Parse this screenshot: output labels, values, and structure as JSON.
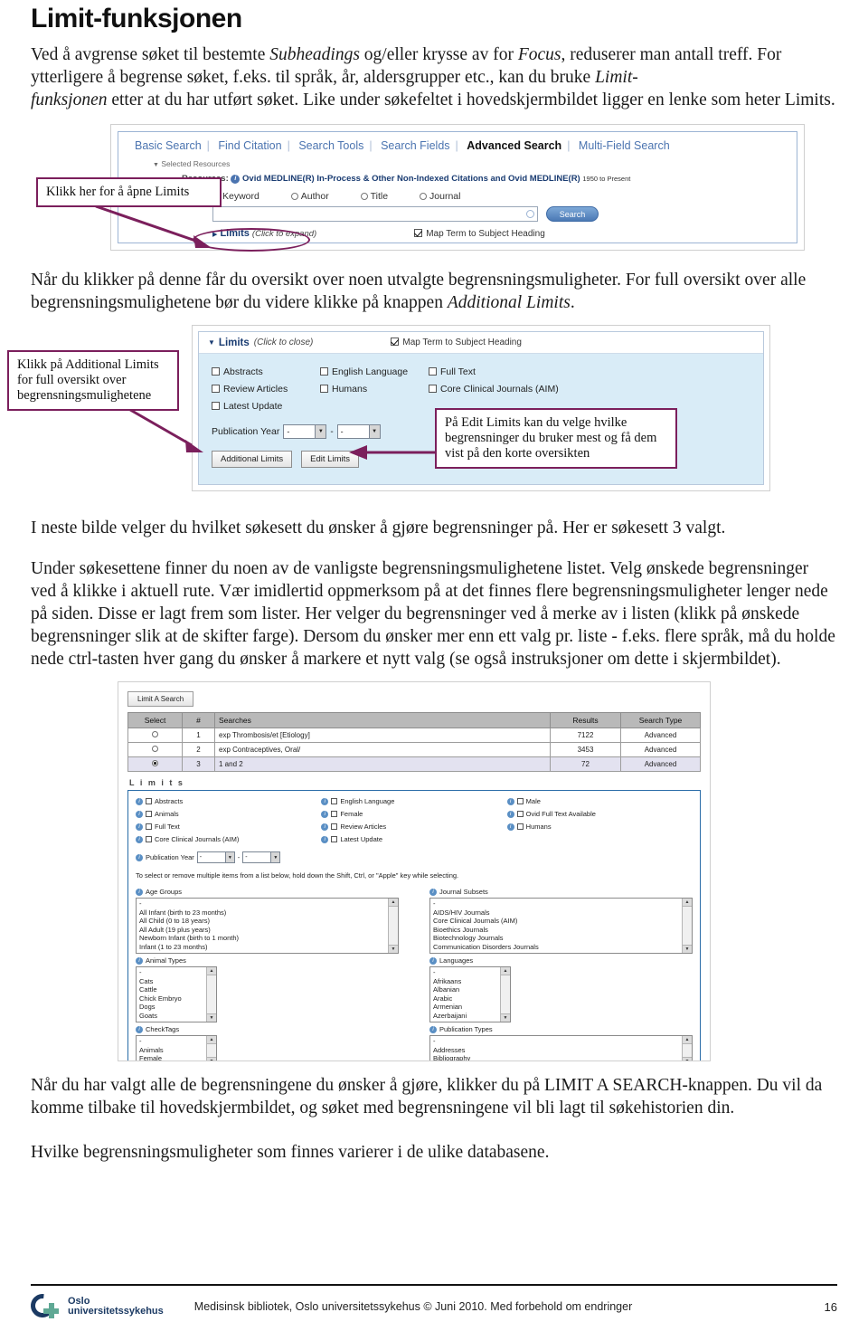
{
  "document": {
    "title": "Limit-funksjonen",
    "paragraphs": {
      "intro": "Ved å avgrense søket til bestemte Subheadings og/eller krysse av for Focus, reduserer man antall treff. For ytterligere å begrense søket, f.eks. til språk, år, aldersgrupper etc., kan du bruke Limit-funksjonen etter at du har utført søket. Like under søkefeltet i hovedskjermbildet ligger en lenke som heter Limits.",
      "after_shot1": "Når du klikker på denne får du oversikt over noen utvalgte begrensningsmuligheter. For full oversikt over alle begrensningsmulighetene bør du videre klikke på knappen Additional Limits.",
      "after_shot2_a": "I neste bilde velger du hvilket søkesett du ønsker å gjøre begrensninger på. Her er søkesett 3 valgt.",
      "after_shot2_b": "Under søkesettene finner du noen av de vanligste begrensningsmulighetene listet. Velg ønskede begrensninger ved å klikke i aktuell rute. Vær imidlertid oppmerksom på at det finnes flere begrensningsmuligheter lenger nede på siden. Disse er lagt frem som lister. Her velger du begrensninger ved å merke av i listen (klikk på ønskede begrensninger slik at de skifter farge). Dersom du ønsker mer enn ett valg pr. liste - f.eks. flere språk, må du holde nede ctrl-tasten hver gang du ønsker å markere et nytt valg (se også instruksjoner om dette i skjermbildet).",
      "after_shot3_a": "Når du har valgt alle de begrensningene du ønsker å gjøre, klikker du på LIMIT A SEARCH-knappen. Du vil da komme tilbake til hovedskjermbildet, og søket med begrensningene vil bli lagt til søkehistorien din.",
      "after_shot3_b": "Hvilke begrensningsmuligheter som finnes varierer i de ulike databasene."
    }
  },
  "callouts": {
    "open_limits": "Klikk her for å åpne Limits",
    "additional_limits": "Klikk på Additional Limits for full oversikt over begrensningsmulighetene",
    "edit_limits": "På Edit Limits kan du velge hvilke begrensninger du bruker mest og få dem vist på den korte oversikten"
  },
  "shot1": {
    "tabs": [
      {
        "label": "Basic Search",
        "active": false
      },
      {
        "label": "Find Citation",
        "active": false
      },
      {
        "label": "Search Tools",
        "active": false
      },
      {
        "label": "Search Fields",
        "active": false
      },
      {
        "label": "Advanced Search",
        "active": true
      },
      {
        "label": "Multi-Field Search",
        "active": false
      }
    ],
    "selected_resources": "Selected Resources",
    "resources_label": "Resources:",
    "resources_value": "Ovid MEDLINE(R) In-Process & Other Non-Indexed Citations and Ovid MEDLINE(R)",
    "resources_years": "1950 to Present",
    "search_modes": [
      {
        "label": "Keyword",
        "selected": true
      },
      {
        "label": "Author",
        "selected": false
      },
      {
        "label": "Title",
        "selected": false
      },
      {
        "label": "Journal",
        "selected": false
      }
    ],
    "search_field_value": "",
    "search_button": "Search",
    "limits_link": "Limits",
    "limits_hint": "(Click to expand)",
    "map_term": "Map Term to Subject Heading"
  },
  "shot2": {
    "header_link": "Limits",
    "header_hint": "(Click to close)",
    "map_term": "Map Term to Subject Heading",
    "checkboxes": [
      "Abstracts",
      "English Language",
      "Full Text",
      "Review Articles",
      "Humans",
      "Core Clinical Journals (AIM)",
      "Latest Update",
      "",
      ""
    ],
    "publication_year_label": "Publication Year",
    "publication_year_from": "-",
    "publication_year_to": "-",
    "additional_limits_button": "Additional Limits",
    "edit_limits_button": "Edit Limits"
  },
  "shot3": {
    "limit_a_search_button": "Limit A Search",
    "table": {
      "columns": [
        "Select",
        "#",
        "Searches",
        "Results",
        "Search Type"
      ],
      "rows": [
        {
          "select": false,
          "num": "1",
          "search": "exp Thrombosis/et [Etiology]",
          "results": "7122",
          "type": "Advanced"
        },
        {
          "select": false,
          "num": "2",
          "search": "exp Contraceptives, Oral/",
          "results": "3453",
          "type": "Advanced"
        },
        {
          "select": true,
          "num": "3",
          "search": "1 and 2",
          "results": "72",
          "type": "Advanced"
        }
      ]
    },
    "limits_label": "L i m i t s",
    "limit_checkboxes": [
      "Abstracts",
      "English Language",
      "Male",
      "Animals",
      "Female",
      "Ovid Full Text Available",
      "Full Text",
      "Review Articles",
      "Humans",
      "Core Clinical Journals (AIM)",
      "Latest Update",
      ""
    ],
    "publication_year_label": "Publication Year",
    "publication_year_from": "-",
    "publication_year_to": "-",
    "multiselect_hint": "To select or remove multiple items from a list below, hold down the Shift, Ctrl, or \"Apple\" key while selecting.",
    "lists": [
      {
        "label": "Age Groups",
        "options": [
          "-",
          "All Infant (birth to 23 months)",
          "All Child (0 to 18 years)",
          "All Adult (19 plus years)",
          "Newborn Infant (birth to 1 month)",
          "Infant (1 to 23 months)"
        ]
      },
      {
        "label": "Journal Subsets",
        "options": [
          "-",
          "AIDS/HIV Journals",
          "Core Clinical Journals (AIM)",
          "Bioethics Journals",
          "Biotechnology Journals",
          "Communication Disorders Journals"
        ]
      },
      {
        "label": "Animal Types",
        "options": [
          "-",
          "Cats",
          "Cattle",
          "Chick Embryo",
          "Dogs",
          "Goats"
        ]
      },
      {
        "label": "Languages",
        "options": [
          "-",
          "Afrikaans",
          "Albanian",
          "Arabic",
          "Armenian",
          "Azerbaijani"
        ]
      },
      {
        "label": "CheckTags",
        "options": [
          "-",
          "Animals",
          "Female"
        ]
      },
      {
        "label": "Publication Types",
        "options": [
          "-",
          "Addresses",
          "Bibliography"
        ]
      }
    ]
  },
  "footer": {
    "logo_line1": "Oslo",
    "logo_line2": "universitetssykehus",
    "text": "Medisinsk bibliotek, Oslo universitetssykehus © Juni 2010. Med forbehold om endringer",
    "page_number": "16"
  },
  "colors": {
    "callout_border": "#7b1f5c",
    "ovid_blue": "#4b74b0",
    "limits_panel_bg": "#d9ecf7",
    "limits_box_border": "#2a6ca8",
    "logo_navy": "#1b3a63",
    "logo_teal": "#5fa894"
  }
}
